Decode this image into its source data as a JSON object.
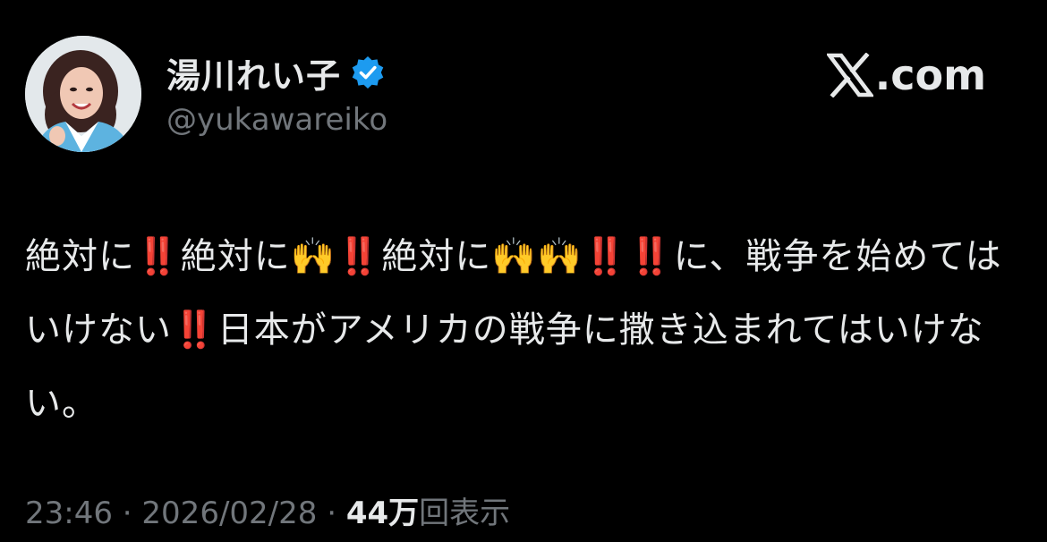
{
  "author": {
    "display_name": "湯川れい子",
    "handle": "@yukawareiko",
    "verified": true,
    "verified_color": "#1d9bf0",
    "avatar_icon": "profile-photo-woman-blue-jacket"
  },
  "brand": {
    "text": ".com",
    "icon": "x-logo-icon"
  },
  "tweet": {
    "text": "絶対に‼️絶対に🙌‼️絶対に🙌🙌‼️‼️に、戦争を始めてはいけない‼️日本がアメリカの戦争に撒き込まれてはいけない。"
  },
  "meta": {
    "time": "23:46",
    "separator": " · ",
    "date": "2026/02/28",
    "views_count": "44万",
    "views_label": "回表示"
  },
  "colors": {
    "background": "#000000",
    "primary_text": "#e7e9ea",
    "secondary_text": "#71767b"
  }
}
